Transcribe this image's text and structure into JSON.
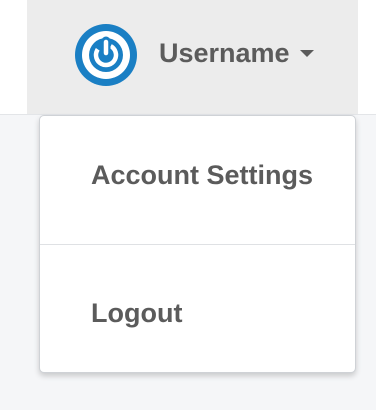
{
  "user_menu": {
    "username": "Username",
    "avatar_icon": "power-icon",
    "caret_icon": "caret-down-icon",
    "avatar_color": "#1a7fc4"
  },
  "dropdown": {
    "items": [
      {
        "label": "Account Settings"
      },
      {
        "label": "Logout"
      }
    ]
  }
}
